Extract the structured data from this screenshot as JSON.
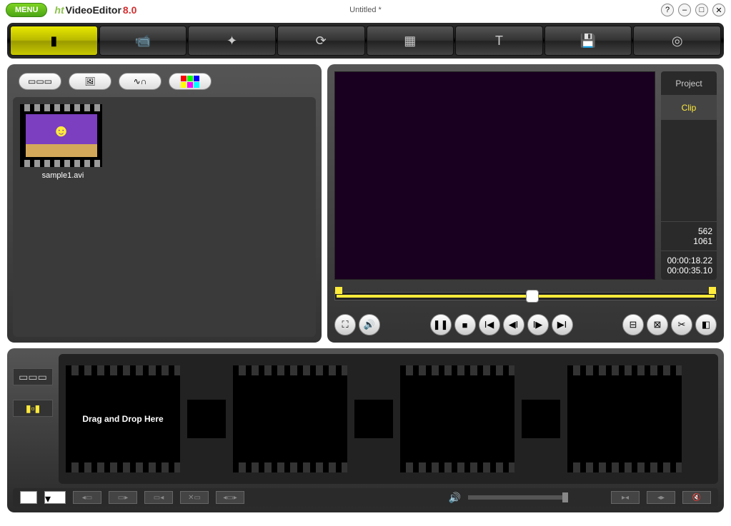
{
  "app": {
    "menu_label": "MENU",
    "logo_prefix": "ht",
    "logo_name": "VideoEditor",
    "logo_version": "8.0",
    "document_title": "Untitled *"
  },
  "library": {
    "clip_name": "sample1.avi"
  },
  "preview": {
    "tab_project": "Project",
    "tab_clip": "Clip",
    "frame_current": "562",
    "frame_total": "1061",
    "time_current": "00:00:18.22",
    "time_total": "00:00:35.10"
  },
  "storyboard": {
    "drop_hint": "Drag and Drop Here"
  }
}
